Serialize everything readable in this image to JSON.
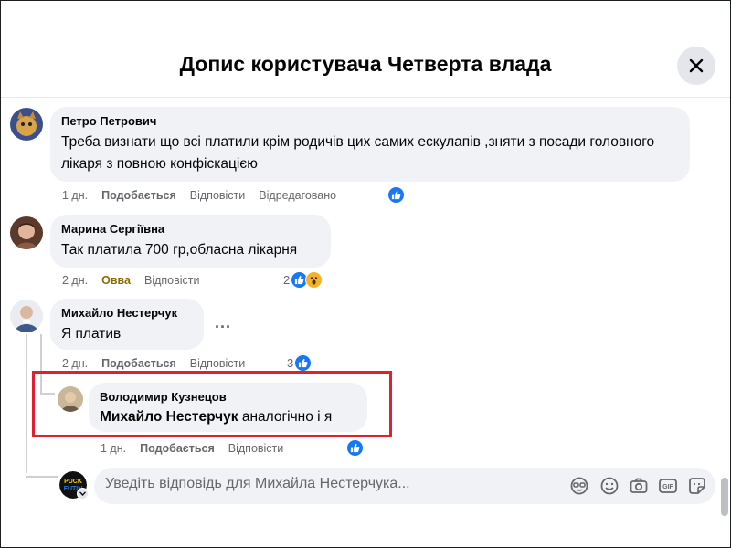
{
  "header": {
    "title": "Допис користувача Четверта влада"
  },
  "comments": [
    {
      "author": "Петро Петрович",
      "text": "Треба визнати що всі платили крім родичів цих самих ескулапів ,зняти з посади головного лікаря з повною конфіскацією",
      "time": "1 дн.",
      "like": "Подобається",
      "reply": "Відповісти",
      "edited": "Відредаговано"
    },
    {
      "author": "Марина Сергіївна",
      "text": "Так платила 700 гр,обласна лікарня",
      "time": "2 дн.",
      "like": "Овва",
      "reply": "Відповісти",
      "reactions_count": "2"
    },
    {
      "author": "Михайло Нестерчук",
      "text": "Я платив",
      "time": "2 дн.",
      "like": "Подобається",
      "reply": "Відповісти",
      "reactions_count": "3",
      "more": "..."
    }
  ],
  "reply": {
    "author": "Володимир Кузнецов",
    "mention": "Михайло Нестерчук",
    "text": " аналогічно і я",
    "time": "1 дн.",
    "like": "Подобається",
    "reply": "Відповісти"
  },
  "composer": {
    "placeholder": "Уведіть відповідь для Михайла Нестерчука...",
    "avatar_text": "PUCK FUTIN",
    "icons": [
      "avatar-sticker-icon",
      "emoji-icon",
      "camera-icon",
      "gif-icon",
      "sticker-icon"
    ]
  },
  "colors": {
    "accent": "#1877f2",
    "highlight": "#e0202f",
    "wow": "#8a6d00",
    "bubble": "#f0f2f5"
  }
}
